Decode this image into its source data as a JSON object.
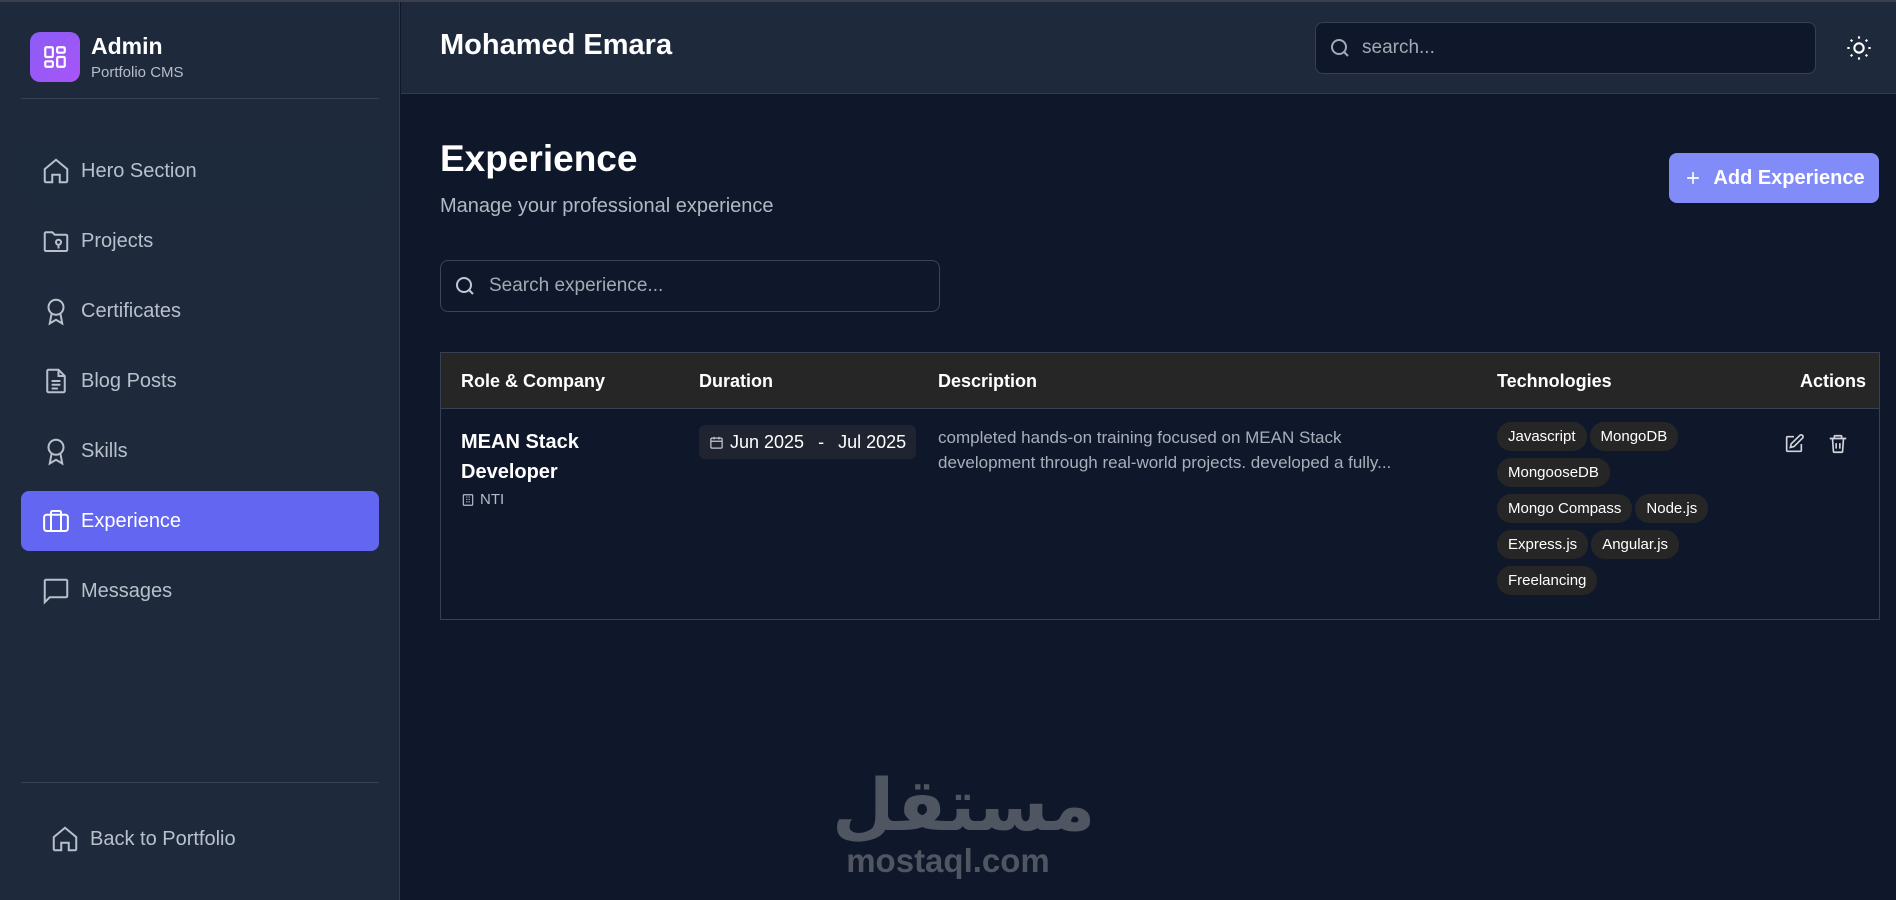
{
  "brand": {
    "title": "Admin",
    "subtitle": "Portfolio CMS"
  },
  "sidebar": {
    "items": [
      {
        "label": "Hero Section",
        "icon": "home-icon"
      },
      {
        "label": "Projects",
        "icon": "folder-icon"
      },
      {
        "label": "Certificates",
        "icon": "award-icon"
      },
      {
        "label": "Blog Posts",
        "icon": "file-text-icon"
      },
      {
        "label": "Skills",
        "icon": "award-icon"
      },
      {
        "label": "Experience",
        "icon": "briefcase-icon",
        "active": true
      },
      {
        "label": "Messages",
        "icon": "message-square-icon"
      }
    ],
    "back_label": "Back to Portfolio"
  },
  "header": {
    "user_name": "Mohamed Emara",
    "search_placeholder": "search..."
  },
  "main": {
    "title": "Experience",
    "subtitle": "Manage your professional experience",
    "add_label": "Add Experience",
    "search_placeholder": "Search experience...",
    "table": {
      "columns": [
        "Role & Company",
        "Duration",
        "Description",
        "Technologies",
        "Actions"
      ],
      "rows": [
        {
          "role": "MEAN Stack Developer",
          "company": "NTI",
          "start": "Jun 2025",
          "separator": "-",
          "end": "Jul 2025",
          "description": "completed hands-on training focused on MEAN Stack development through real-world projects. developed a fully...",
          "technologies": [
            "Javascript",
            "MongoDB",
            "MongooseDB",
            "Mongo Compass",
            "Node.js",
            "Express.js",
            "Angular.js",
            "Freelancing"
          ]
        }
      ]
    }
  },
  "watermark": {
    "arabic": "مستقل",
    "latin": "mostaql.com"
  },
  "colors": {
    "accent": "#6366f1",
    "button": "#818cf8",
    "background": "#0f172a",
    "panel": "#1e293b"
  }
}
